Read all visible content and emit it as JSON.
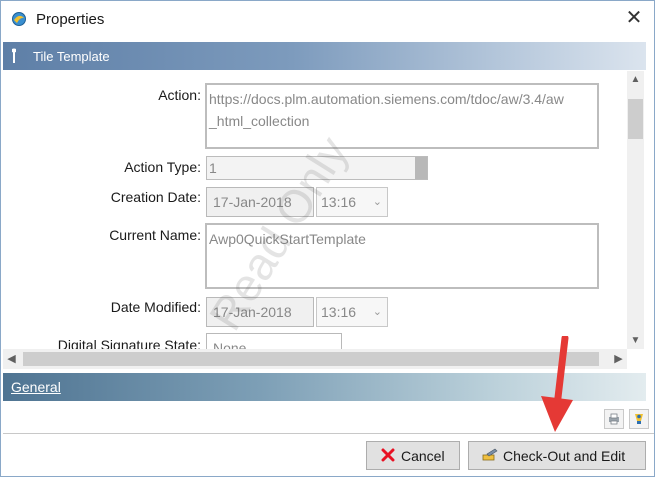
{
  "window": {
    "title": "Properties",
    "close_glyph": "✕"
  },
  "section": {
    "title": "Tile Template"
  },
  "fields": {
    "action_label": "Action:",
    "action_value_line1": "https://docs.plm.automation.siemens.com/tdoc/aw/3.4/aw",
    "action_value_line2": "_html_collection",
    "action_type_label": "Action Type:",
    "action_type_value": "1",
    "creation_date_label": "Creation Date:",
    "creation_date_value": "17-Jan-2018",
    "creation_time_value": "13:16",
    "current_name_label": "Current Name:",
    "current_name_value": "Awp0QuickStartTemplate",
    "date_modified_label": "Date Modified:",
    "date_modified_value": "17-Jan-2018",
    "modified_time_value": "13:16",
    "digital_signature_label": "Digital Signature State:",
    "digital_signature_value": "None"
  },
  "watermark": "Read Only",
  "general_tab": {
    "label": "General"
  },
  "buttons": {
    "cancel_label": "Cancel",
    "checkout_label": "Check-Out and Edit"
  },
  "icons": {
    "app": "teamcenter-app-icon",
    "wrench": "wrench-icon",
    "cancel": "red-x-icon",
    "checkout": "checkout-edit-icon",
    "annotation": "red-arrow-annotation"
  },
  "colors": {
    "section_header": "#5e7fa7",
    "general_bar": "#4f7492",
    "cancel_icon": "#e81123",
    "annotation_arrow": "#e53935"
  }
}
